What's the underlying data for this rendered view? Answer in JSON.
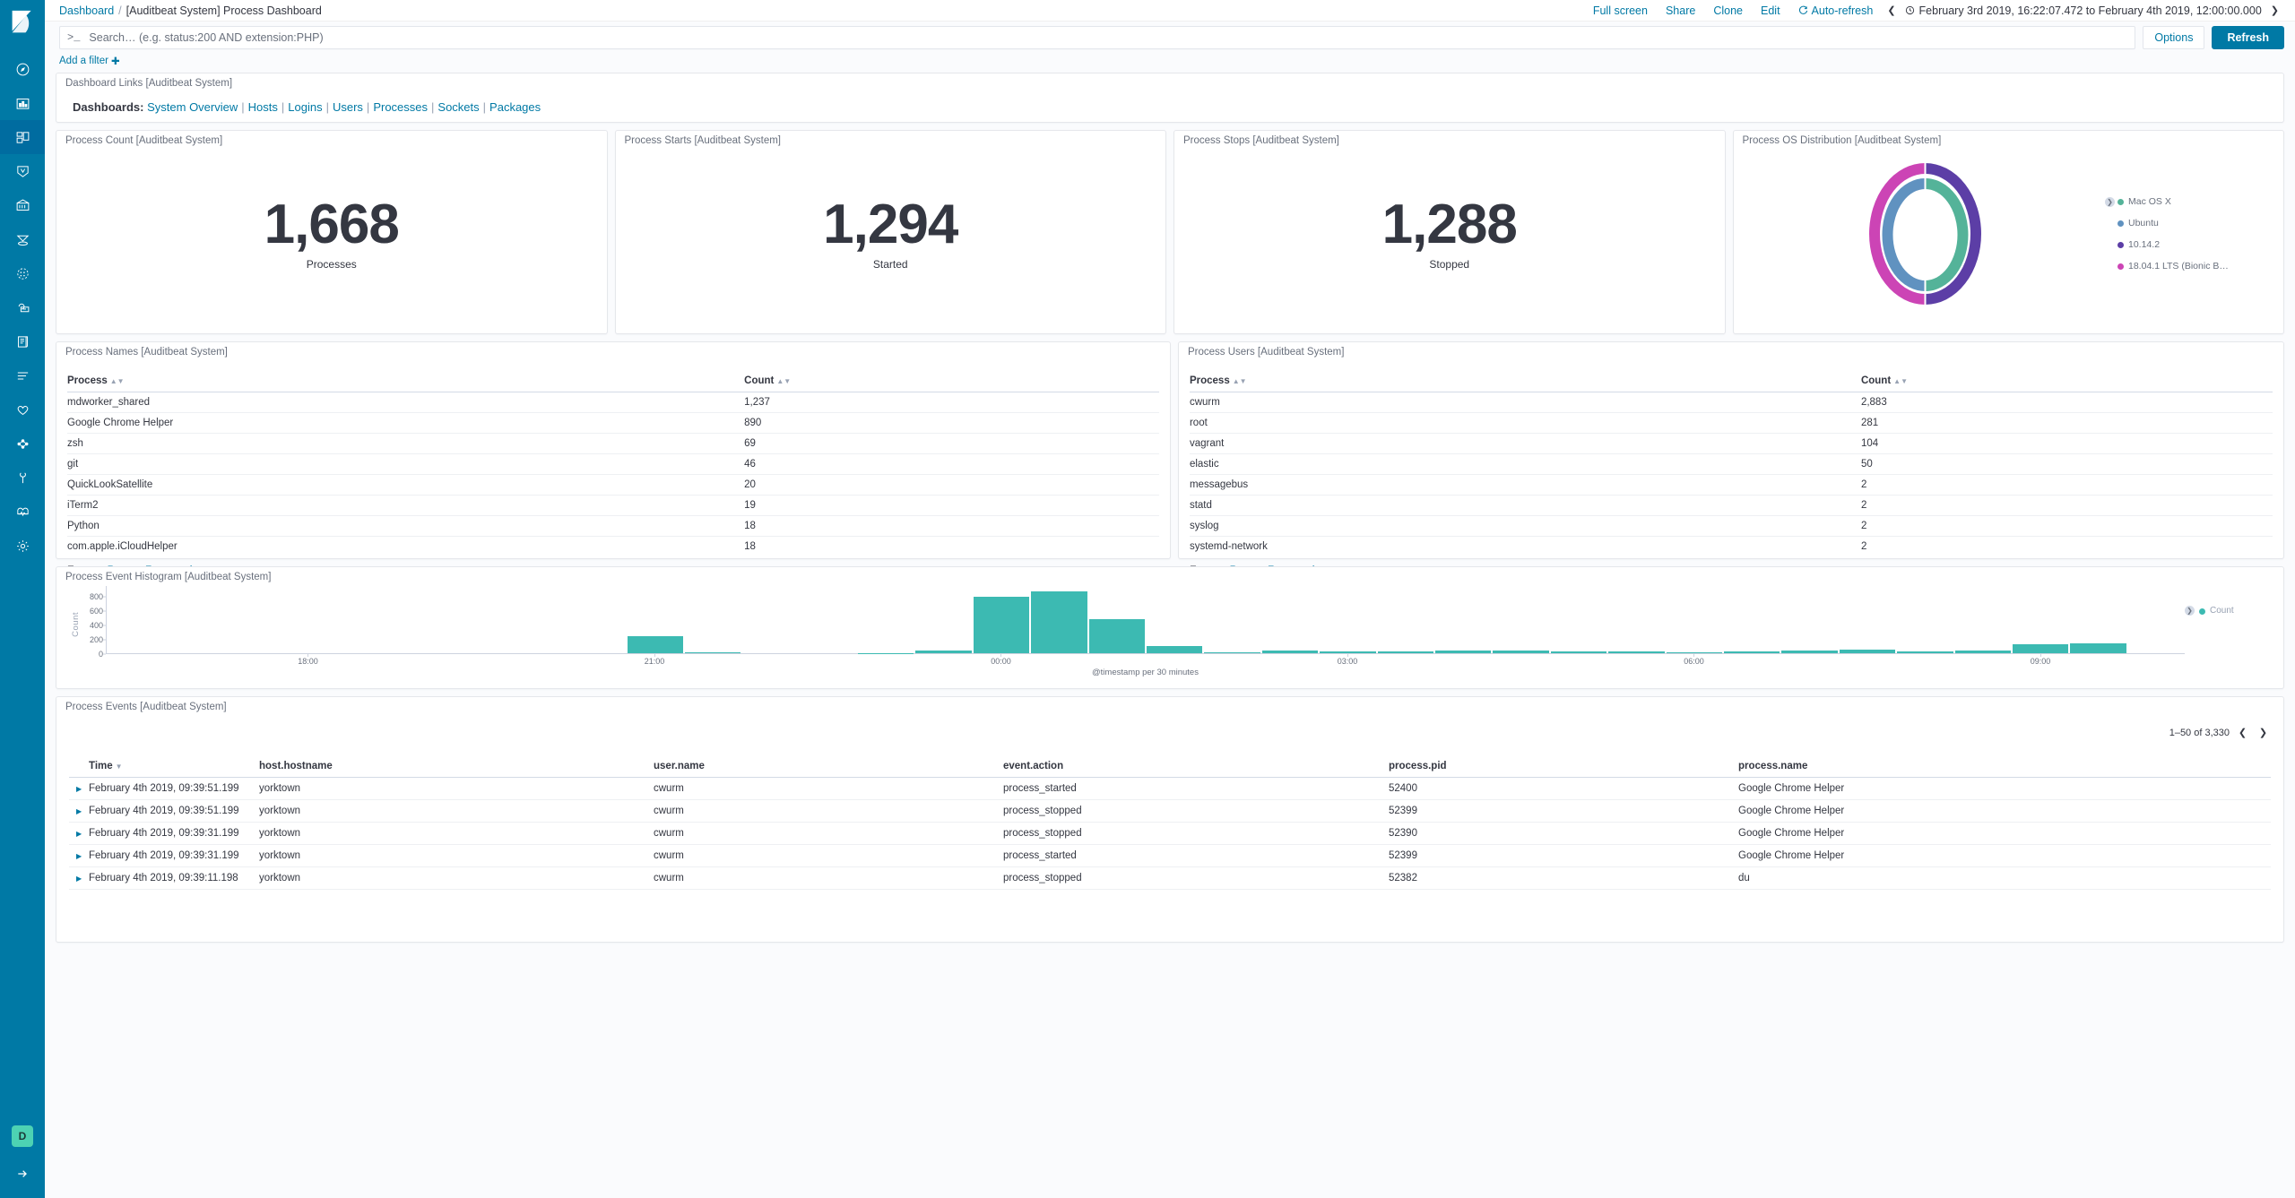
{
  "sidebar": {
    "logo_name": "kibana-logo",
    "items": [
      {
        "name": "discover",
        "icon": "compass-icon",
        "active": false
      },
      {
        "name": "visualize",
        "icon": "bar-chart-icon",
        "active": false
      },
      {
        "name": "dashboard",
        "icon": "dashboard-icon",
        "active": true
      },
      {
        "name": "canvas",
        "icon": "canvas-icon",
        "active": false
      },
      {
        "name": "maps",
        "icon": "maps-icon",
        "active": false
      },
      {
        "name": "machine-learning",
        "icon": "ml-icon",
        "active": false
      },
      {
        "name": "infrastructure",
        "icon": "infrastructure-icon",
        "active": false
      },
      {
        "name": "apm",
        "icon": "apm-icon",
        "active": false
      },
      {
        "name": "logs",
        "icon": "logs-icon",
        "active": false
      },
      {
        "name": "uptime",
        "icon": "uptime-icon",
        "active": false
      },
      {
        "name": "siem",
        "icon": "siem-icon",
        "active": false
      },
      {
        "name": "graph",
        "icon": "graph-icon",
        "active": false
      },
      {
        "name": "dev-tools",
        "icon": "wrench-icon",
        "active": false
      },
      {
        "name": "monitoring",
        "icon": "monitoring-icon",
        "active": false
      },
      {
        "name": "management",
        "icon": "gear-icon",
        "active": false
      }
    ],
    "avatar_initial": "D",
    "collapse_label": "collapse"
  },
  "header": {
    "breadcrumb_root": "Dashboard",
    "breadcrumb_sep": "/",
    "breadcrumb_current": "[Auditbeat System] Process Dashboard",
    "actions": [
      "Full screen",
      "Share",
      "Clone",
      "Edit"
    ],
    "auto_refresh": "Auto-refresh",
    "date_range": "February 3rd 2019, 16:22:07.472 to February 4th 2019, 12:00:00.000",
    "prev_label": "❮",
    "next_label": "❯"
  },
  "query": {
    "prompt": ">_",
    "value": "",
    "placeholder": "Search… (e.g. status:200 AND extension:PHP)",
    "options_label": "Options",
    "refresh_label": "Refresh",
    "add_filter_label": "Add a filter"
  },
  "links_panel": {
    "title": "Dashboard Links [Auditbeat System]",
    "prefix": "Dashboards",
    "colon": ":",
    "links": [
      "System Overview",
      "Hosts",
      "Logins",
      "Users",
      "Processes",
      "Sockets",
      "Packages"
    ]
  },
  "metrics": [
    {
      "title": "Process Count [Auditbeat System]",
      "value": "1,668",
      "label": "Processes"
    },
    {
      "title": "Process Starts [Auditbeat System]",
      "value": "1,294",
      "label": "Started"
    },
    {
      "title": "Process Stops [Auditbeat System]",
      "value": "1,288",
      "label": "Stopped"
    }
  ],
  "donut_panel": {
    "title": "Process OS Distribution [Auditbeat System]",
    "expander": "❯",
    "legend": [
      {
        "label": "Mac OS X",
        "color": "#54b399"
      },
      {
        "label": "Ubuntu",
        "color": "#6092c0"
      },
      {
        "label": "10.14.2",
        "color": "#5c3ea6"
      },
      {
        "label": "18.04.1 LTS (Bionic B…",
        "color": "#cc44b5"
      }
    ]
  },
  "process_names_panel": {
    "title": "Process Names [Auditbeat System]",
    "columns": [
      "Process",
      "Count"
    ],
    "rows": [
      [
        "mdworker_shared",
        "1,237"
      ],
      [
        "Google Chrome Helper",
        "890"
      ],
      [
        "zsh",
        "69"
      ],
      [
        "git",
        "46"
      ],
      [
        "QuickLookSatellite",
        "20"
      ],
      [
        "iTerm2",
        "19"
      ],
      [
        "Python",
        "18"
      ],
      [
        "com.apple.iCloudHelper",
        "18"
      ]
    ],
    "export_label": "Export:",
    "export_raw": "Raw",
    "export_formatted": "Formatted"
  },
  "process_users_panel": {
    "title": "Process Users [Auditbeat System]",
    "columns": [
      "Process",
      "Count"
    ],
    "rows": [
      [
        "cwurm",
        "2,883"
      ],
      [
        "root",
        "281"
      ],
      [
        "vagrant",
        "104"
      ],
      [
        "elastic",
        "50"
      ],
      [
        "messagebus",
        "2"
      ],
      [
        "statd",
        "2"
      ],
      [
        "syslog",
        "2"
      ],
      [
        "systemd-network",
        "2"
      ]
    ],
    "export_label": "Export:",
    "export_raw": "Raw",
    "export_formatted": "Formatted"
  },
  "histogram_panel": {
    "title": "Process Event Histogram [Auditbeat System]",
    "legend_label": "Count",
    "legend_color": "#3cbab2",
    "expander": "❯"
  },
  "chart_data": [
    {
      "type": "pie",
      "title": "Process OS Distribution [Auditbeat System]",
      "legend_position": "right",
      "rings": [
        {
          "name": "os.family",
          "slices": [
            {
              "label": "Mac OS X",
              "value": 50,
              "color": "#54b399"
            },
            {
              "label": "Ubuntu",
              "value": 50,
              "color": "#6092c0"
            }
          ]
        },
        {
          "name": "os.version",
          "slices": [
            {
              "label": "10.14.2",
              "value": 50,
              "color": "#5c3ea6"
            },
            {
              "label": "18.04.1 LTS (Bionic B…",
              "value": 50,
              "color": "#cc44b5"
            }
          ]
        }
      ]
    },
    {
      "type": "bar",
      "title": "Process Event Histogram [Auditbeat System]",
      "xlabel": "@timestamp per 30 minutes",
      "ylabel": "Count",
      "ylim": [
        0,
        900
      ],
      "yticks": [
        0,
        200,
        400,
        600,
        800
      ],
      "xticks": [
        "18:00",
        "21:00",
        "00:00",
        "03:00",
        "06:00",
        "09:00"
      ],
      "grid": false,
      "legend": [
        "Count"
      ],
      "categories": [
        "16:30",
        "17:00",
        "17:30",
        "18:00",
        "18:30",
        "19:00",
        "19:30",
        "20:00",
        "20:30",
        "21:00",
        "21:30",
        "22:00",
        "22:30",
        "23:00",
        "23:30",
        "00:00",
        "00:30",
        "01:00",
        "01:30",
        "02:00",
        "02:30",
        "03:00",
        "03:30",
        "04:00",
        "04:30",
        "05:00",
        "05:30",
        "06:00",
        "06:30",
        "07:00",
        "07:30",
        "08:00",
        "08:30",
        "09:00",
        "09:30",
        "10:00"
      ],
      "values": [
        0,
        0,
        0,
        0,
        0,
        0,
        0,
        0,
        0,
        230,
        12,
        0,
        0,
        3,
        35,
        760,
        830,
        460,
        100,
        8,
        40,
        28,
        24,
        40,
        32,
        28,
        26,
        18,
        30,
        42,
        46,
        22,
        34,
        120,
        130,
        0
      ]
    }
  ],
  "events_panel": {
    "title": "Process Events [Auditbeat System]",
    "pagination": "1–50 of 3,330",
    "prev_label": "❮",
    "next_label": "❯",
    "columns": [
      "Time",
      "host.hostname",
      "user.name",
      "event.action",
      "process.pid",
      "process.name"
    ],
    "rows": [
      [
        "February 4th 2019, 09:39:51.199",
        "yorktown",
        "cwurm",
        "process_started",
        "52400",
        "Google Chrome Helper"
      ],
      [
        "February 4th 2019, 09:39:51.199",
        "yorktown",
        "cwurm",
        "process_stopped",
        "52399",
        "Google Chrome Helper"
      ],
      [
        "February 4th 2019, 09:39:31.199",
        "yorktown",
        "cwurm",
        "process_stopped",
        "52390",
        "Google Chrome Helper"
      ],
      [
        "February 4th 2019, 09:39:31.199",
        "yorktown",
        "cwurm",
        "process_started",
        "52399",
        "Google Chrome Helper"
      ],
      [
        "February 4th 2019, 09:39:11.198",
        "yorktown",
        "cwurm",
        "process_stopped",
        "52382",
        "du"
      ]
    ]
  },
  "colors": {
    "brand": "#0079a5",
    "teal": "#3cbab2",
    "text": "#343741",
    "muted": "#69707d"
  }
}
